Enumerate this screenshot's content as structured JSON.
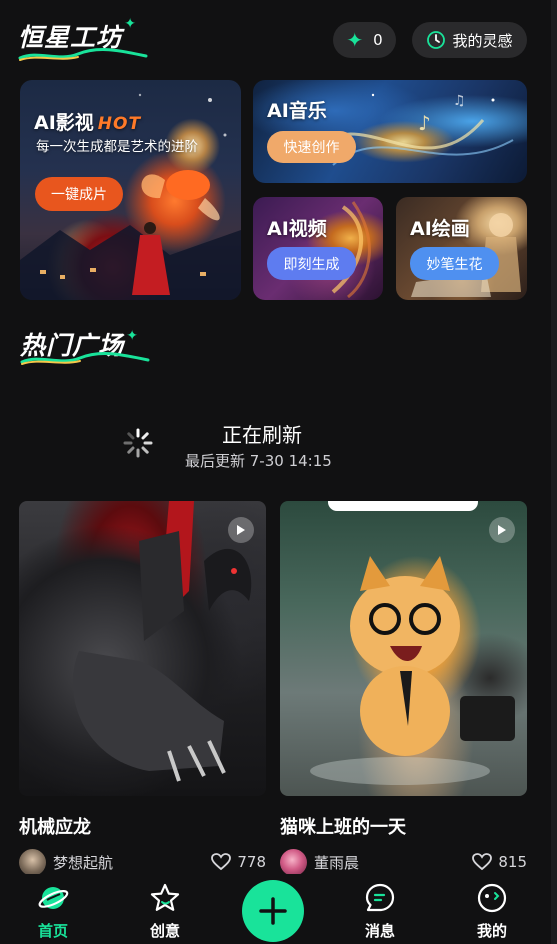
{
  "header": {
    "brand": "恒星工坊",
    "stars_count": "0",
    "inspiration_label": "我的灵感"
  },
  "features": {
    "video": {
      "title": "AI影视",
      "badge": "HOT",
      "subtitle": "每一次生成都是艺术的进阶",
      "button": "一键成片"
    },
    "music": {
      "title": "AI音乐",
      "button": "快速创作"
    },
    "aivideo": {
      "title": "AI视频",
      "button": "即刻生成"
    },
    "draw": {
      "title": "AI绘画",
      "button": "妙笔生花"
    }
  },
  "section": {
    "title": "热门广场"
  },
  "refresh": {
    "title": "正在刷新",
    "subtitle": "最后更新 7-30 14:15"
  },
  "posts": [
    {
      "title": "机械应龙",
      "author": "梦想起航",
      "likes": "778"
    },
    {
      "title": "猫咪上班的一天",
      "author": "董雨晨",
      "likes": "815"
    }
  ],
  "nav": {
    "items": [
      {
        "label": "首页",
        "icon": "planet-icon",
        "active": true
      },
      {
        "label": "创意",
        "icon": "star-outline-icon",
        "active": false
      },
      {
        "label": "消息",
        "icon": "chat-icon",
        "active": false
      },
      {
        "label": "我的",
        "icon": "face-icon",
        "active": false
      }
    ],
    "add_icon": "plus-icon"
  },
  "colors": {
    "accent": "#19e39a",
    "background": "#111112",
    "hot": "#ff7a28"
  }
}
